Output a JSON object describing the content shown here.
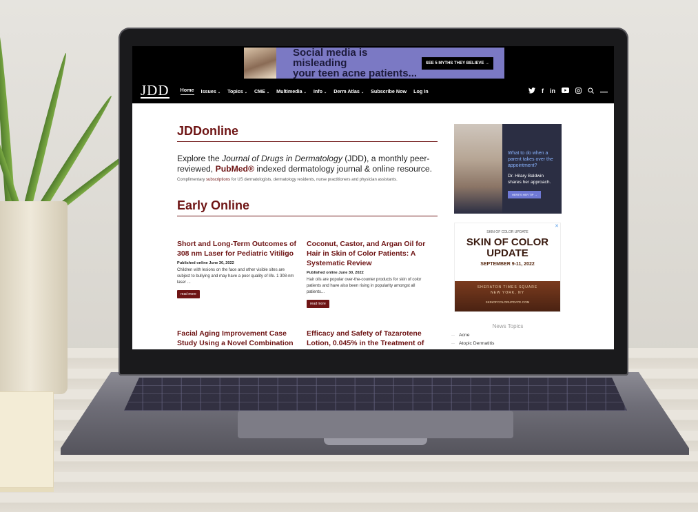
{
  "ad_banner": {
    "headline_line1": "Social media is misleading",
    "headline_line2": "your teen acne patients...",
    "cta": "SEE 5 MYTHS THEY BELIEVE →"
  },
  "nav": {
    "logo": "JDD",
    "items": [
      {
        "label": "Home"
      },
      {
        "label": "Issues",
        "caret": "⌄"
      },
      {
        "label": "Topics",
        "caret": "⌄"
      },
      {
        "label": "CME",
        "caret": "⌄"
      },
      {
        "label": "Multimedia",
        "caret": "⌄"
      },
      {
        "label": "Info",
        "caret": "⌄"
      },
      {
        "label": "Derm Atlas",
        "caret": "⌄"
      },
      {
        "label": "Subscribe Now"
      },
      {
        "label": "Log In"
      }
    ],
    "social": [
      "twitter-icon",
      "facebook-icon",
      "linkedin-icon",
      "youtube-icon",
      "instagram-icon",
      "search-icon",
      "menu-icon"
    ]
  },
  "main": {
    "title": "JDDonline",
    "intro_part1": "Explore the ",
    "intro_journal": "Journal of Drugs in Dermatology",
    "intro_part2": " (JDD), a monthly peer-reviewed,",
    "intro_link": "PubMed®",
    "intro_part3": " indexed dermatology journal & online resource.",
    "sub_part1": "Complimentary ",
    "sub_link": "subscriptions",
    "sub_part2": " for US dermatologists, dermatology residents, nurse practitioners and physician assistants.",
    "early_title": "Early Online"
  },
  "articles": [
    {
      "title": "Short and Long-Term Outcomes of 308 nm Laser for Pediatric Vitiligo",
      "date": "Published online June 30, 2022",
      "excerpt": "Children with lesions on the face and other visible sites are subject to bullying and may have a poor quality of life. 1 308-nm laser ...",
      "button": "read more"
    },
    {
      "title": "Coconut, Castor, and Argan Oil for Hair in Skin of Color Patients: A Systematic Review",
      "date": "Published online June 30, 2022",
      "excerpt": "Hair oils are popular over-the-counter products for skin of color patients and have also been rising in popularity amongst all patients...",
      "button": "read more"
    },
    {
      "title": "Facial Aging Improvement Case Study Using a Novel Combination of Retinol,"
    },
    {
      "title": "Efficacy and Safety of Tazarotene Lotion, 0.045% in the Treatment of"
    }
  ],
  "side_ad1": {
    "question": "What to do when a parent takes over the appointment?",
    "name": "Dr. Hilary Baldwin shares her approach.",
    "cta": "HERE'S HER TIP →"
  },
  "side_ad2": {
    "logo": "SKIN OF COLOR UPDATE",
    "title_line1": "SKIN OF COLOR",
    "title_line2": "UPDATE",
    "dates": "SEPTEMBER 9-11, 2022",
    "venue1": "SHERATON TIMES SQUARE",
    "venue2": "NEW YORK, NY",
    "url": "SKINOFCOLORUPDATE.COM",
    "close": "✕"
  },
  "topics": {
    "title": "News Topics",
    "items": [
      "Acne",
      "Atopic Dermatitis"
    ]
  }
}
